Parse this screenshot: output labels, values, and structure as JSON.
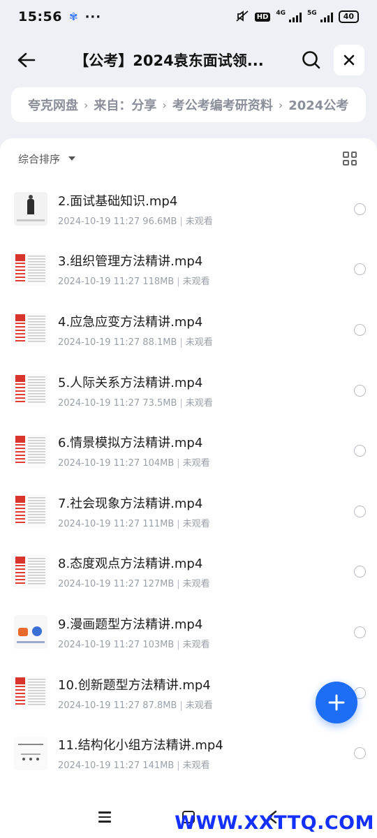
{
  "status_bar": {
    "time": "15:56",
    "battery": "40",
    "net_4g": "4G",
    "net_5g": "5G",
    "hd": "HD"
  },
  "header": {
    "title": "【公考】2024袁东面试领..."
  },
  "breadcrumb": [
    "夸克网盘",
    "来自：分享",
    "考公考编考研资料",
    "2024公考"
  ],
  "sort": {
    "label": "综合排序"
  },
  "files": [
    {
      "name": "2.面试基础知识.mp4",
      "date": "2024-10-19 11:27",
      "size": "96.6MB",
      "status": "未观看",
      "thumb": "person"
    },
    {
      "name": "3.组织管理方法精讲.mp4",
      "date": "2024-10-19 11:27",
      "size": "118MB",
      "status": "未观看",
      "thumb": "doc"
    },
    {
      "name": "4.应急应变方法精讲.mp4",
      "date": "2024-10-19 11:27",
      "size": "88.1MB",
      "status": "未观看",
      "thumb": "doc"
    },
    {
      "name": "5.人际关系方法精讲.mp4",
      "date": "2024-10-19 11:27",
      "size": "73.5MB",
      "status": "未观看",
      "thumb": "doc"
    },
    {
      "name": "6.情景模拟方法精讲.mp4",
      "date": "2024-10-19 11:27",
      "size": "104MB",
      "status": "未观看",
      "thumb": "doc"
    },
    {
      "name": "7.社会现象方法精讲.mp4",
      "date": "2024-10-19 11:27",
      "size": "111MB",
      "status": "未观看",
      "thumb": "doc"
    },
    {
      "name": "8.态度观点方法精讲.mp4",
      "date": "2024-10-19 11:27",
      "size": "127MB",
      "status": "未观看",
      "thumb": "doc"
    },
    {
      "name": "9.漫画题型方法精讲.mp4",
      "date": "2024-10-19 11:27",
      "size": "103MB",
      "status": "未观看",
      "thumb": "cartoon"
    },
    {
      "name": "10.创新题型方法精讲.mp4",
      "date": "2024-10-19 11:27",
      "size": "87.8MB",
      "status": "未观看",
      "thumb": "doc"
    },
    {
      "name": "11.结构化小组方法精讲.mp4",
      "date": "2024-10-19 11:27",
      "size": "141MB",
      "status": "未观看",
      "thumb": "diagram"
    }
  ],
  "watermark": "WWW.XXTTQ.COM",
  "colors": {
    "accent": "#1e6ef5",
    "watermark": "#1330ff"
  }
}
